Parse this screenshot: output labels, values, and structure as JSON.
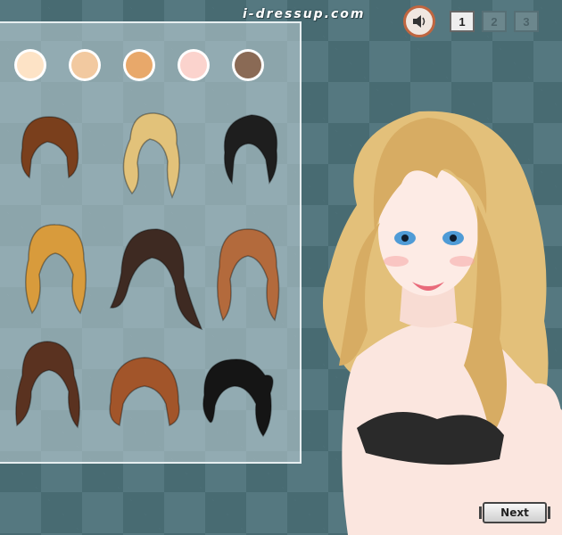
{
  "header": {
    "logo_text": "i-dressup.com",
    "sound_icon": "speaker-icon",
    "pages": [
      "1",
      "2",
      "3"
    ],
    "active_page": "1"
  },
  "palette": {
    "skin_tones": [
      "#fde3c6",
      "#f2c9a0",
      "#e8a86a",
      "#fbd3cd",
      "#8a6a55"
    ]
  },
  "hairstyles": [
    {
      "name": "short-brown-bob",
      "color": "#7a3f1c"
    },
    {
      "name": "long-blonde-wavy",
      "color": "#e2c27a"
    },
    {
      "name": "black-updo",
      "color": "#1e1e1e"
    },
    {
      "name": "golden-layered",
      "color": "#d89b3c"
    },
    {
      "name": "dark-brown-long",
      "color": "#3e2a22"
    },
    {
      "name": "auburn-long",
      "color": "#b36a3c"
    },
    {
      "name": "brown-curly",
      "color": "#5a3220"
    },
    {
      "name": "copper-short",
      "color": "#a2552a"
    },
    {
      "name": "black-bun",
      "color": "#151515"
    }
  ],
  "footer": {
    "next_label": "Next"
  }
}
